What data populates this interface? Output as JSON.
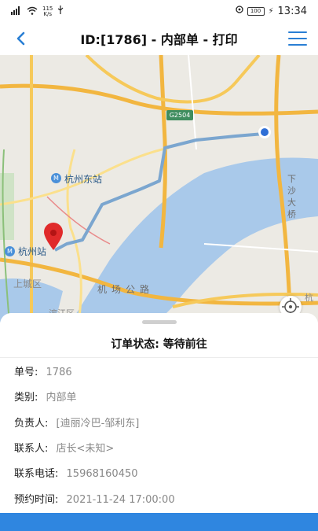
{
  "status_bar": {
    "speed_value": "115",
    "speed_unit": "K/s",
    "battery": "100",
    "time": "13:34"
  },
  "header": {
    "title": "ID:[1786] - 内部单 - 打印"
  },
  "map": {
    "labels": {
      "hangzhou_east": "杭州东站",
      "hangzhou_station": "杭州站",
      "shangcheng": "上城区",
      "binjiang": "滨江区",
      "airport_road": "机场公路",
      "xiasha_bridge": "下沙大桥",
      "hang": "杭",
      "g2504": "G2504"
    },
    "route_color": "#7ba6cf",
    "marker_color": "#e02a2a",
    "water_color": "#a9c9ea"
  },
  "order": {
    "status_label": "订单状态: 等待前往",
    "fields": [
      {
        "label": "单号:",
        "value": "1786"
      },
      {
        "label": "类别:",
        "value": "内部单"
      },
      {
        "label": "负责人:",
        "value": "[迪丽冷巴-邹利东]"
      },
      {
        "label": "联系人:",
        "value": "店长<未知>"
      },
      {
        "label": "联系电话:",
        "value": "15968160450"
      },
      {
        "label": "预约时间:",
        "value": "2021-11-24 17:00:00"
      }
    ]
  },
  "accent_color": "#2f86e0"
}
